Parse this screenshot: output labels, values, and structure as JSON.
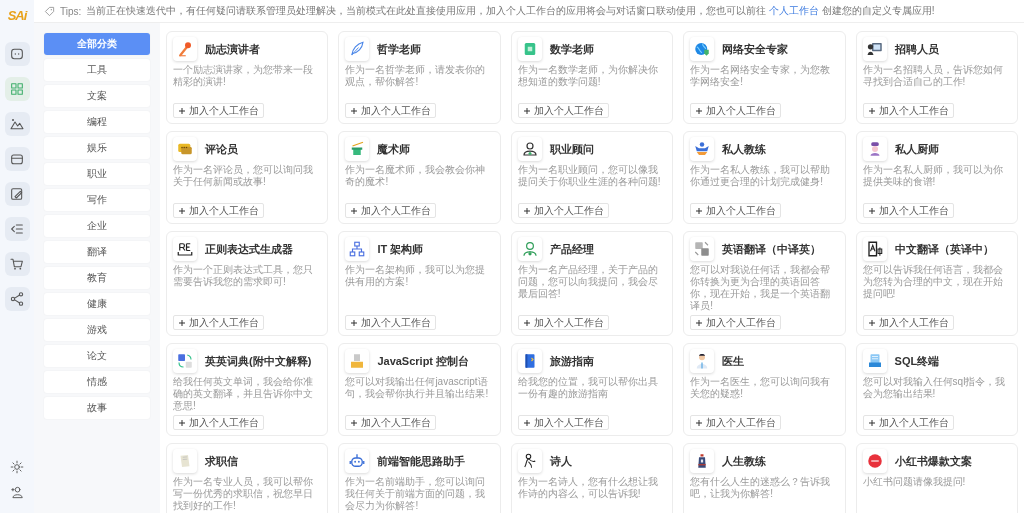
{
  "logo": "SAi",
  "rail": [
    {
      "selected": false
    },
    {
      "selected": true
    },
    {
      "selected": false
    },
    {
      "selected": false
    },
    {
      "selected": false
    },
    {
      "selected": false
    },
    {
      "selected": false
    },
    {
      "selected": false
    }
  ],
  "tips": {
    "label": "Tips:",
    "text_before": "当前正在快速迭代中，有任何疑问请联系管理员处理解决，当前模式在此处直接使用应用，加入个人工作台的应用将会与对话窗口联动使用，您也可以前往 ",
    "link": "个人工作台",
    "text_after": " 创建您的自定义专属应用!"
  },
  "categories": [
    {
      "label": "全部分类",
      "selected": true
    },
    {
      "label": "工具",
      "selected": false
    },
    {
      "label": "文案",
      "selected": false
    },
    {
      "label": "编程",
      "selected": false
    },
    {
      "label": "娱乐",
      "selected": false
    },
    {
      "label": "职业",
      "selected": false
    },
    {
      "label": "写作",
      "selected": false
    },
    {
      "label": "企业",
      "selected": false
    },
    {
      "label": "翻译",
      "selected": false
    },
    {
      "label": "教育",
      "selected": false
    },
    {
      "label": "健康",
      "selected": false
    },
    {
      "label": "游戏",
      "selected": false
    },
    {
      "label": "论文",
      "selected": false
    },
    {
      "label": "情感",
      "selected": false
    },
    {
      "label": "故事",
      "selected": false
    }
  ],
  "apps": [
    {
      "title": "励志演讲者",
      "description": "一个励志演讲家，为您带来一段精彩的演讲!",
      "button": "加入个人工作台"
    },
    {
      "title": "哲学老师",
      "description": "作为一名哲学老师，请发表你的观点，帮你解答!",
      "button": "加入个人工作台"
    },
    {
      "title": "数学老师",
      "description": "作为一名数学老师，为你解决你想知道的数学问题!",
      "button": "加入个人工作台"
    },
    {
      "title": "网络安全专家",
      "description": "作为一名网络安全专家，为您教学网络安全!",
      "button": "加入个人工作台"
    },
    {
      "title": "招聘人员",
      "description": "作为一名招聘人员，告诉您如何寻找到合适自己的工作!",
      "button": "加入个人工作台"
    },
    {
      "title": "评论员",
      "description": "作为一名评论员，您可以询问我关于任何新闻或故事!",
      "button": "加入个人工作台"
    },
    {
      "title": "魔术师",
      "description": "作为一名魔术师，我会教会你神奇的魔术!",
      "button": "加入个人工作台"
    },
    {
      "title": "职业顾问",
      "description": "作为一名职业顾问，您可以像我提问关于你职业生涯的各种问题!",
      "button": "加入个人工作台"
    },
    {
      "title": "私人教练",
      "description": "作为一名私人教练，我可以帮助你通过更合理的计划完成健身!",
      "button": "加入个人工作台"
    },
    {
      "title": "私人厨师",
      "description": "作为一名私人厨师，我可以为你提供美味的食谱!",
      "button": "加入个人工作台"
    },
    {
      "title": "正则表达式生成器",
      "description": "作为一个正则表达式工具，您只需要告诉我您的需求即可!",
      "button": "加入个人工作台"
    },
    {
      "title": "IT 架构师",
      "description": "作为一名架构师，我可以为您提供有用的方案!",
      "button": "加入个人工作台"
    },
    {
      "title": "产品经理",
      "description": "作为一名产品经理，关于产品的问题，您可以向我提问，我会尽最后回答!",
      "button": "加入个人工作台"
    },
    {
      "title": "英语翻译（中译英）",
      "description": "您可以对我说任何话，我都会帮你转换为更为合理的英语回答你，现在开始，我是一个英语翻译员!",
      "button": "加入个人工作台"
    },
    {
      "title": "中文翻译（英译中）",
      "description": "您可以告诉我任何语言，我都会为您转为合理的中文，现在开始提问吧!",
      "button": "加入个人工作台"
    },
    {
      "title": "英英词典(附中文解释)",
      "description": "给我任何英文单词，我会给你准确的英文翻译，并且告诉你中文意思!",
      "button": "加入个人工作台"
    },
    {
      "title": "JavaScript 控制台",
      "description": "您可以对我输出任何javascript语句，我会帮你执行并且输出结果!",
      "button": "加入个人工作台"
    },
    {
      "title": "旅游指南",
      "description": "给我您的位置，我可以帮你出具一份有趣的旅游指南",
      "button": "加入个人工作台"
    },
    {
      "title": "医生",
      "description": "作为一名医生，您可以询问我有关您的疑惑!",
      "button": "加入个人工作台"
    },
    {
      "title": "SQL终端",
      "description": "您可以对我输入任何sql指令，我会为您输出结果!",
      "button": "加入个人工作台"
    },
    {
      "title": "求职信",
      "description": "作为一名专业人员，我可以帮你写一份优秀的求职信，祝您早日找到好的工作!"
    },
    {
      "title": "前端智能思路助手",
      "description": "作为一名前端助手，您可以询问我任何关于前端方面的问题，我会尽力为你解答!"
    },
    {
      "title": "诗人",
      "description": "作为一名诗人，您有什么想让我作诗的内容么，可以告诉我!"
    },
    {
      "title": "人生教练",
      "description": "您有什么人生的迷惑么？告诉我吧，让我为你解答!"
    },
    {
      "title": "小红书爆款文案",
      "description": "小红书问题请像我提问!"
    }
  ]
}
